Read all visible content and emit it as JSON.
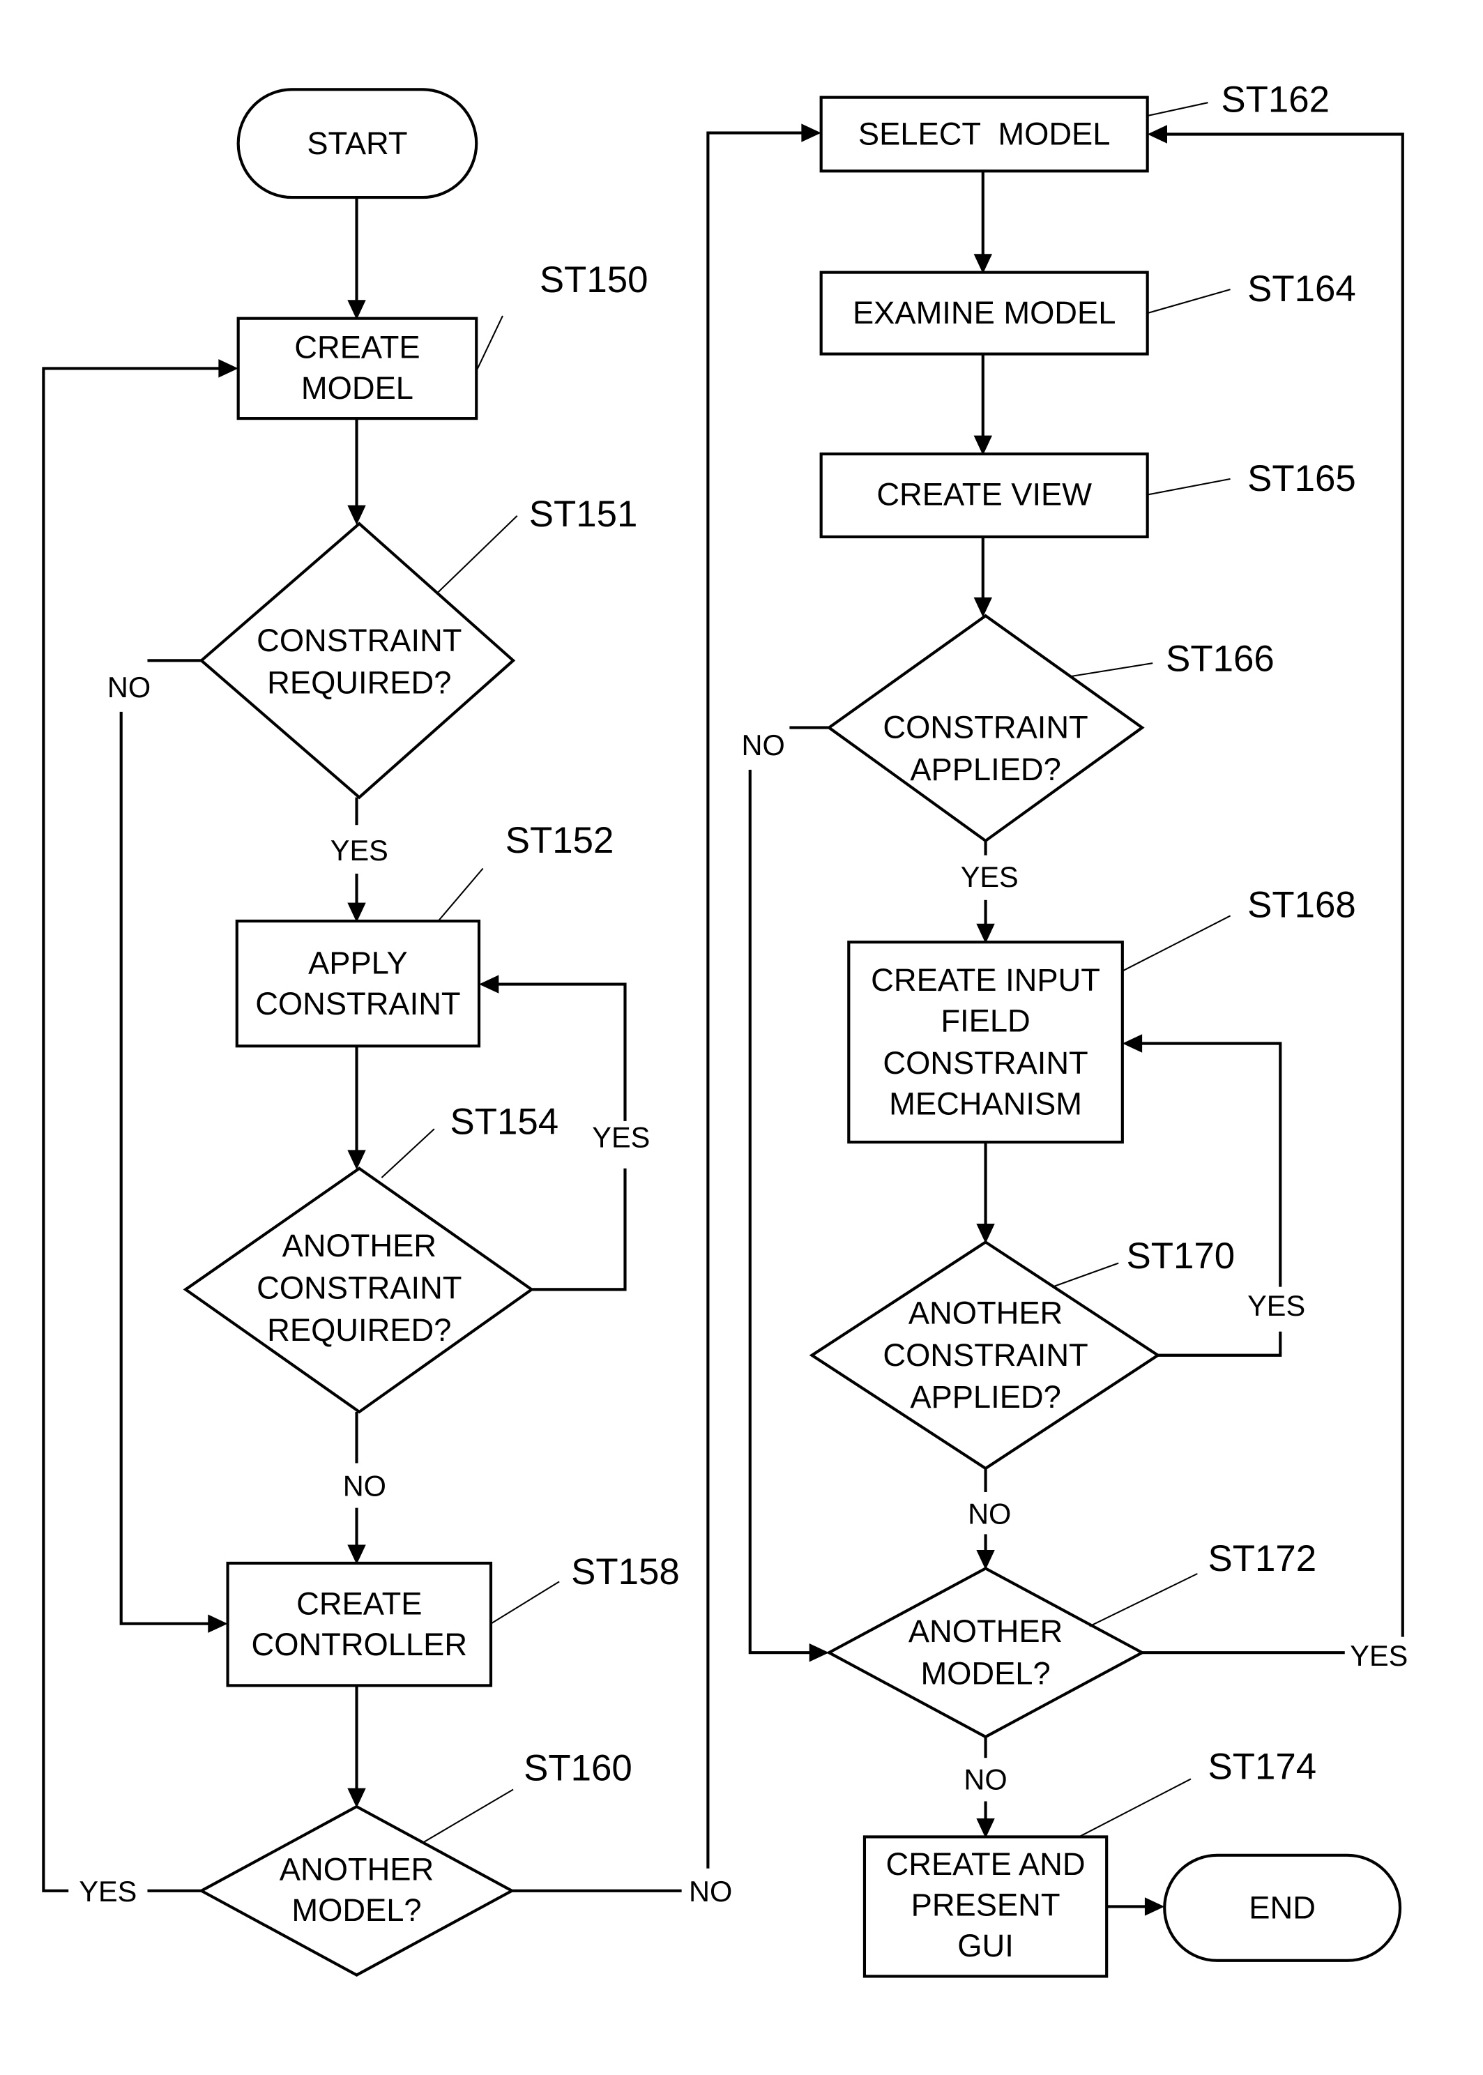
{
  "diagram": {
    "type": "flowchart",
    "nodes": {
      "start": {
        "shape": "terminal",
        "lines": [
          "START"
        ]
      },
      "st150": {
        "shape": "process",
        "ref": "ST150",
        "lines": [
          "CREATE",
          "MODEL"
        ]
      },
      "st151": {
        "shape": "decision",
        "ref": "ST151",
        "lines": [
          "CONSTRAINT",
          "REQUIRED?"
        ]
      },
      "st152": {
        "shape": "process",
        "ref": "ST152",
        "lines": [
          "APPLY",
          "CONSTRAINT"
        ]
      },
      "st154": {
        "shape": "decision",
        "ref": "ST154",
        "lines": [
          "ANOTHER",
          "CONSTRAINT",
          "REQUIRED?"
        ]
      },
      "st158": {
        "shape": "process",
        "ref": "ST158",
        "lines": [
          "CREATE",
          "CONTROLLER"
        ]
      },
      "st160": {
        "shape": "decision",
        "ref": "ST160",
        "lines": [
          "ANOTHER",
          "MODEL?"
        ]
      },
      "st162": {
        "shape": "process",
        "ref": "ST162",
        "lines": [
          "SELECT  MODEL"
        ]
      },
      "st164": {
        "shape": "process",
        "ref": "ST164",
        "lines": [
          "EXAMINE MODEL"
        ]
      },
      "st165": {
        "shape": "process",
        "ref": "ST165",
        "lines": [
          "CREATE VIEW"
        ]
      },
      "st166": {
        "shape": "decision",
        "ref": "ST166",
        "lines": [
          "CONSTRAINT",
          "APPLIED?"
        ]
      },
      "st168": {
        "shape": "process",
        "ref": "ST168",
        "lines": [
          "CREATE INPUT",
          "FIELD",
          "CONSTRAINT",
          "MECHANISM"
        ]
      },
      "st170": {
        "shape": "decision",
        "ref": "ST170",
        "lines": [
          "ANOTHER",
          "CONSTRAINT",
          "APPLIED?"
        ]
      },
      "st172": {
        "shape": "decision",
        "ref": "ST172",
        "lines": [
          "ANOTHER",
          "MODEL?"
        ]
      },
      "st174": {
        "shape": "process",
        "ref": "ST174",
        "lines": [
          "CREATE AND",
          "PRESENT",
          "GUI"
        ]
      },
      "end": {
        "shape": "terminal",
        "lines": [
          "END"
        ]
      }
    },
    "edge_labels": {
      "st151_no": "NO",
      "st151_yes": "YES",
      "st154_yes": "YES",
      "st154_no": "NO",
      "st160_yes": "YES",
      "st160_no": "NO",
      "st166_no": "NO",
      "st166_yes": "YES",
      "st170_yes": "YES",
      "st170_no": "NO",
      "st172_yes": "YES",
      "st172_no": "NO"
    },
    "edges": [
      {
        "from": "start",
        "to": "st150"
      },
      {
        "from": "st150",
        "to": "st151"
      },
      {
        "from": "st151",
        "to": "st152",
        "label": "YES"
      },
      {
        "from": "st151",
        "to": "st158",
        "label": "NO"
      },
      {
        "from": "st152",
        "to": "st154"
      },
      {
        "from": "st154",
        "to": "st152",
        "label": "YES"
      },
      {
        "from": "st154",
        "to": "st158",
        "label": "NO"
      },
      {
        "from": "st158",
        "to": "st160"
      },
      {
        "from": "st160",
        "to": "st150",
        "label": "YES"
      },
      {
        "from": "st160",
        "to": "st162",
        "label": "NO"
      },
      {
        "from": "st162",
        "to": "st164"
      },
      {
        "from": "st164",
        "to": "st165"
      },
      {
        "from": "st165",
        "to": "st166"
      },
      {
        "from": "st166",
        "to": "st168",
        "label": "YES"
      },
      {
        "from": "st166",
        "to": "st172",
        "label": "NO"
      },
      {
        "from": "st168",
        "to": "st170"
      },
      {
        "from": "st170",
        "to": "st168",
        "label": "YES"
      },
      {
        "from": "st170",
        "to": "st172",
        "label": "NO"
      },
      {
        "from": "st172",
        "to": "st162",
        "label": "YES"
      },
      {
        "from": "st172",
        "to": "st174",
        "label": "NO"
      },
      {
        "from": "st174",
        "to": "end"
      }
    ]
  }
}
